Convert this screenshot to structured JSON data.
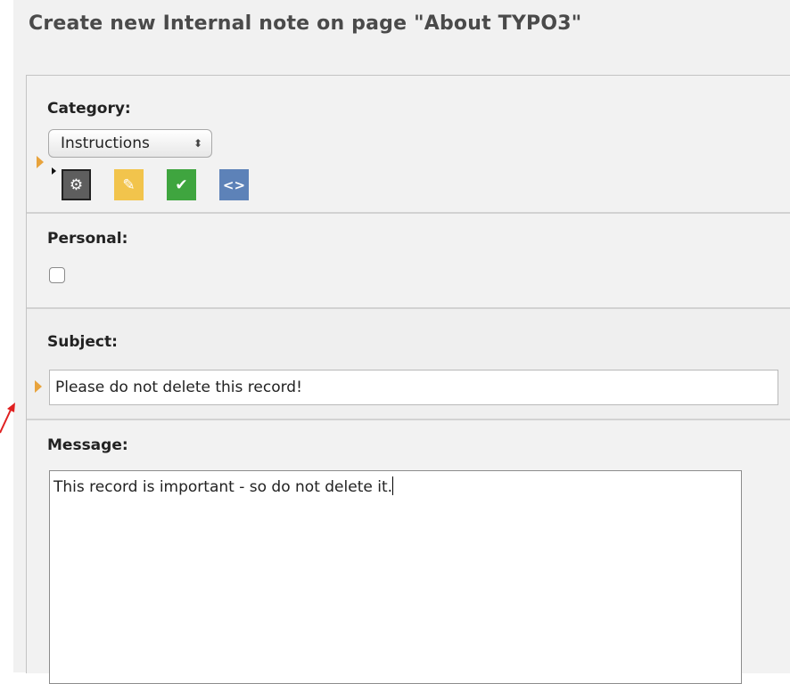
{
  "page": {
    "title": "Create new Internal note on page \"About TYPO3\""
  },
  "category": {
    "label": "Category:",
    "selected": "Instructions",
    "select_arrows": "⬍",
    "icons": [
      {
        "name": "gear-icon",
        "color": "#5e5e5e",
        "glyph": "⚙"
      },
      {
        "name": "pin-icon",
        "color": "#f2c44c",
        "glyph": "✎"
      },
      {
        "name": "check-icon",
        "color": "#3fa53f",
        "glyph": "✔"
      },
      {
        "name": "code-icon",
        "color": "#5d82b8",
        "glyph": "<>"
      }
    ]
  },
  "personal": {
    "label": "Personal:",
    "checked": false
  },
  "subject": {
    "label": "Subject:",
    "value": "Please do not delete this record!"
  },
  "message": {
    "label": "Message:",
    "value": "This record is important - so do not delete it."
  },
  "colors": {
    "marker": "#e8a33c",
    "annotation_arrow": "#e02020"
  }
}
